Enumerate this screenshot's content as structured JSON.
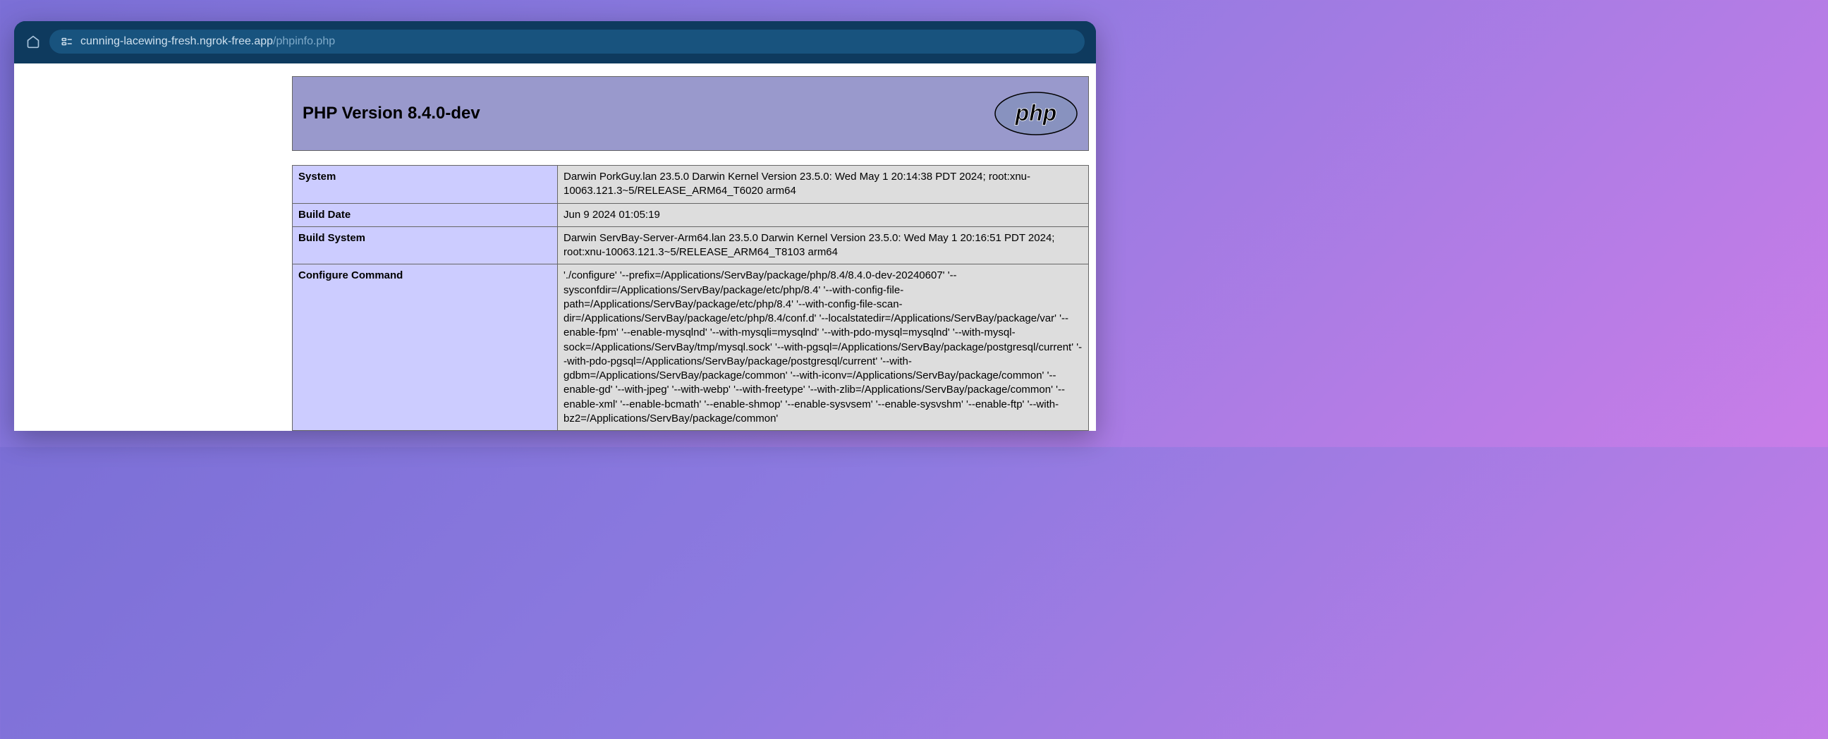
{
  "browser": {
    "url_domain": "cunning-lacewing-fresh.ngrok-free.app",
    "url_path": "/phpinfo.php"
  },
  "phpinfo": {
    "title": "PHP Version 8.4.0-dev",
    "logo_alt": "php",
    "rows": [
      {
        "label": "System",
        "value": "Darwin PorkGuy.lan 23.5.0 Darwin Kernel Version 23.5.0: Wed May 1 20:14:38 PDT 2024; root:xnu-10063.121.3~5/RELEASE_ARM64_T6020 arm64"
      },
      {
        "label": "Build Date",
        "value": "Jun 9 2024 01:05:19"
      },
      {
        "label": "Build System",
        "value": "Darwin ServBay-Server-Arm64.lan 23.5.0 Darwin Kernel Version 23.5.0: Wed May 1 20:16:51 PDT 2024; root:xnu-10063.121.3~5/RELEASE_ARM64_T8103 arm64"
      },
      {
        "label": "Configure Command",
        "value": "'./configure' '--prefix=/Applications/ServBay/package/php/8.4/8.4.0-dev-20240607' '--sysconfdir=/Applications/ServBay/package/etc/php/8.4' '--with-config-file-path=/Applications/ServBay/package/etc/php/8.4' '--with-config-file-scan-dir=/Applications/ServBay/package/etc/php/8.4/conf.d' '--localstatedir=/Applications/ServBay/package/var' '--enable-fpm' '--enable-mysqlnd' '--with-mysqli=mysqlnd' '--with-pdo-mysql=mysqlnd' '--with-mysql-sock=/Applications/ServBay/tmp/mysql.sock' '--with-pgsql=/Applications/ServBay/package/postgresql/current' '--with-pdo-pgsql=/Applications/ServBay/package/postgresql/current' '--with-gdbm=/Applications/ServBay/package/common' '--with-iconv=/Applications/ServBay/package/common' '--enable-gd' '--with-jpeg' '--with-webp' '--with-freetype' '--with-zlib=/Applications/ServBay/package/common' '--enable-xml' '--enable-bcmath' '--enable-shmop' '--enable-sysvsem' '--enable-sysvshm' '--enable-ftp' '--with-bz2=/Applications/ServBay/package/common'"
      }
    ]
  }
}
